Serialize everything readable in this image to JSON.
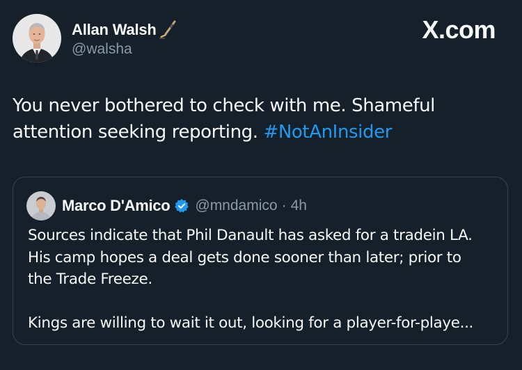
{
  "brand": {
    "label": "X.com"
  },
  "author": {
    "display_name": "Allan Walsh",
    "handle": "@walsha",
    "emoji_icon": "hockey-stick-icon"
  },
  "tweet": {
    "text_part1": "You never bothered to check with me.  Shameful attention seeking reporting.  ",
    "hashtag": "#NotAnInsider"
  },
  "quoted_tweet": {
    "display_name": "Marco D'Amico",
    "verified_icon": "verified-badge-icon",
    "handle": "@mndamico",
    "separator": "·",
    "time": "4h",
    "lines": [
      "Sources indicate that Phil Danault has asked for a tradein LA.",
      "His camp hopes a deal gets done sooner than later; prior to",
      "the Trade Freeze."
    ],
    "last_line": "Kings are willing to wait it out, looking for a player-for-playe..."
  },
  "colors": {
    "background": "#15202b",
    "text": "#f7f9f9",
    "secondary_text": "#8b98a5",
    "accent": "#1d9bf0",
    "border": "#38444d"
  }
}
